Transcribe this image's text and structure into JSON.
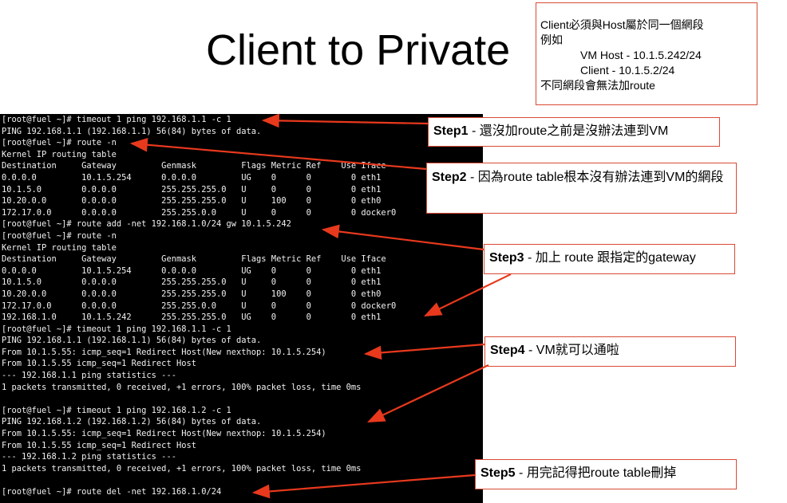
{
  "slide_title": "Client to Private",
  "note_box": {
    "line1": "Client必須與Host屬於同一個網段",
    "line2": "例如",
    "line3": "VM Host - 10.1.5.242/24",
    "line4": "Client - 10.1.5.2/24",
    "line5": "不同網段會無法加route"
  },
  "terminal_lines": [
    "[root@fuel ~]# timeout 1 ping 192.168.1.1 -c 1",
    "PING 192.168.1.1 (192.168.1.1) 56(84) bytes of data.",
    "[root@fuel ~]# route -n",
    "Kernel IP routing table",
    "Destination     Gateway         Genmask         Flags Metric Ref    Use Iface",
    "0.0.0.0         10.1.5.254      0.0.0.0         UG    0      0        0 eth1",
    "10.1.5.0        0.0.0.0         255.255.255.0   U     0      0        0 eth1",
    "10.20.0.0       0.0.0.0         255.255.255.0   U     100    0        0 eth0",
    "172.17.0.0      0.0.0.0         255.255.0.0     U     0      0        0 docker0",
    "[root@fuel ~]# route add -net 192.168.1.0/24 gw 10.1.5.242",
    "[root@fuel ~]# route -n",
    "Kernel IP routing table",
    "Destination     Gateway         Genmask         Flags Metric Ref    Use Iface",
    "0.0.0.0         10.1.5.254      0.0.0.0         UG    0      0        0 eth1",
    "10.1.5.0        0.0.0.0         255.255.255.0   U     0      0        0 eth1",
    "10.20.0.0       0.0.0.0         255.255.255.0   U     100    0        0 eth0",
    "172.17.0.0      0.0.0.0         255.255.0.0     U     0      0        0 docker0",
    "192.168.1.0     10.1.5.242      255.255.255.0   UG    0      0        0 eth1",
    "[root@fuel ~]# timeout 1 ping 192.168.1.1 -c 1",
    "PING 192.168.1.1 (192.168.1.1) 56(84) bytes of data.",
    "From 10.1.5.55: icmp_seq=1 Redirect Host(New nexthop: 10.1.5.254)",
    "From 10.1.5.55 icmp_seq=1 Redirect Host",
    "--- 192.168.1.1 ping statistics ---",
    "1 packets transmitted, 0 received, +1 errors, 100% packet loss, time 0ms",
    "",
    "[root@fuel ~]# timeout 1 ping 192.168.1.2 -c 1",
    "PING 192.168.1.2 (192.168.1.2) 56(84) bytes of data.",
    "From 10.1.5.55: icmp_seq=1 Redirect Host(New nexthop: 10.1.5.254)",
    "From 10.1.5.55 icmp_seq=1 Redirect Host",
    "--- 192.168.1.2 ping statistics ---",
    "1 packets transmitted, 0 received, +1 errors, 100% packet loss, time 0ms",
    "",
    "[root@fuel ~]# route del -net 192.168.1.0/24"
  ],
  "callouts": {
    "step1": {
      "label": "Step1",
      "text": " - 還沒加route之前是沒辦法連到VM"
    },
    "step2": {
      "label": "Step2",
      "text": " - 因為route table根本沒有辦法連到VM的網段"
    },
    "step3": {
      "label": "Step3",
      "text": " - 加上 route 跟指定的gateway"
    },
    "step4": {
      "label": "Step4",
      "text": " - VM就可以通啦"
    },
    "step5": {
      "label": "Step5",
      "text": " - 用完記得把route table刪掉"
    }
  },
  "colors": {
    "accent": "#e8391d",
    "terminal_bg": "#000000",
    "terminal_fg": "#f2f2f2"
  }
}
